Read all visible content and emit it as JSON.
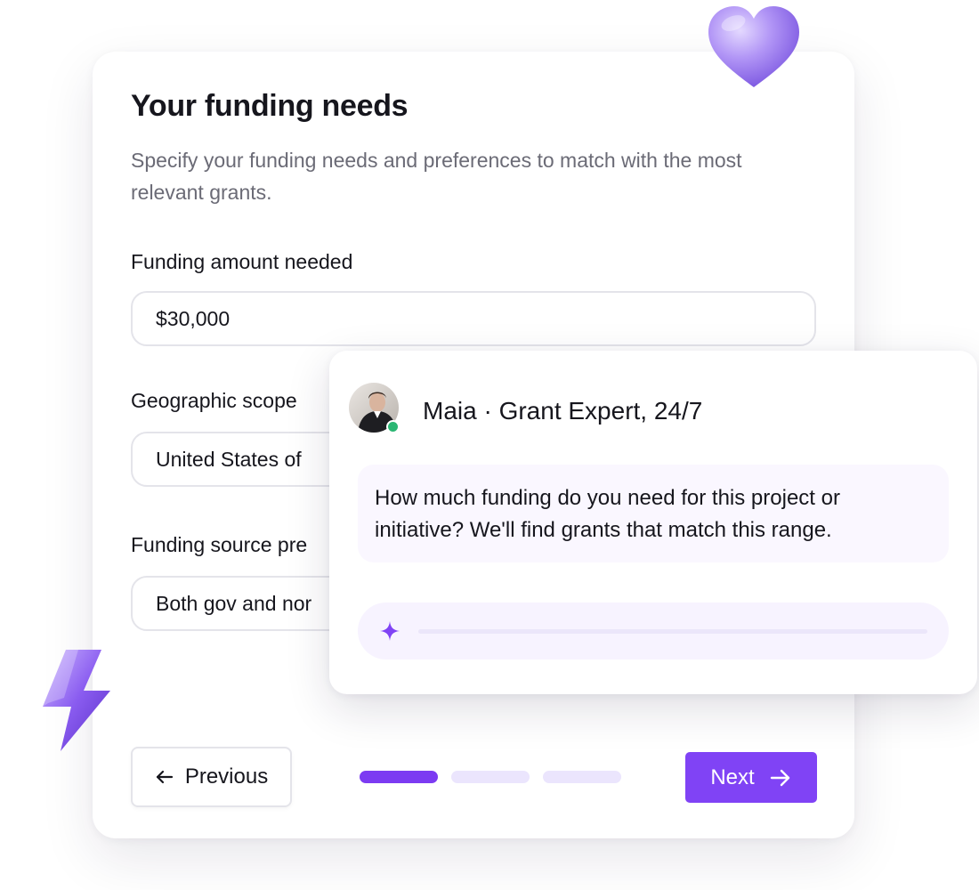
{
  "form": {
    "title": "Your funding needs",
    "description": "Specify your funding needs and preferences to match with the most relevant grants.",
    "fields": [
      {
        "label": "Funding amount needed",
        "value": "$30,000"
      },
      {
        "label": "Geographic scope",
        "value": "United States of"
      },
      {
        "label": "Funding source pre",
        "value": "Both gov and nor"
      }
    ],
    "previous_label": "Previous",
    "next_label": "Next",
    "progress": {
      "current_step": 1,
      "total_steps": 3
    }
  },
  "chat": {
    "title": "Maia · Grant Expert, 24/7",
    "message": "How much funding do you need for this project or initiative? We'll find grants that match this range.",
    "status": "online"
  },
  "icons": {
    "previous": "arrow-left-icon",
    "next": "arrow-right-icon",
    "input": "sparkle-icon",
    "decoration_top": "heart-icon",
    "decoration_left": "lightning-bolt-icon"
  },
  "colors": {
    "accent": "#8043f5",
    "progress_active": "#7c3bf2",
    "progress_inactive": "#ebe5fd",
    "online": "#2bb673",
    "bubble_background": "#faf7ff"
  }
}
